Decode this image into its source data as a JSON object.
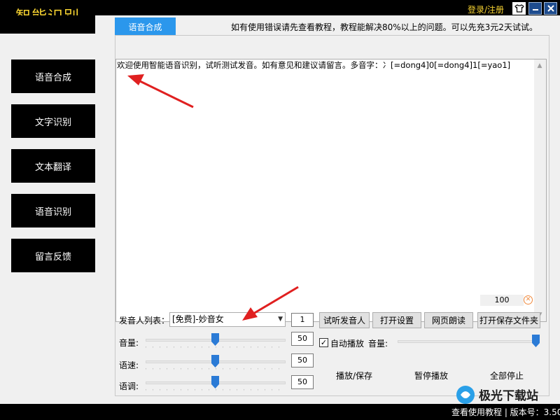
{
  "app": {
    "title": "智能识别",
    "login_label": "登录/注册",
    "notice": "如有使用错误请先查看教程，教程能解决80%以上的问题。可以先充3元2天试试。"
  },
  "sidebar": {
    "items": [
      {
        "label": "语音合成"
      },
      {
        "label": "文字识别"
      },
      {
        "label": "文本翻译"
      },
      {
        "label": "语音识别"
      },
      {
        "label": "留言反馈"
      }
    ]
  },
  "tab": {
    "label": "语音合成"
  },
  "editor": {
    "text": "欢迎使用智能语音识别，试听测试发音。如有意见和建议请留言。多音字：冫[=dong4]0[=dong4]1[=yao1]",
    "char_count": "100"
  },
  "voice": {
    "list_label": "发音人列表：",
    "selected": "[免费]-妙音女",
    "count": "1"
  },
  "buttons": {
    "preview": "试听发音人",
    "settings": "打开设置",
    "web_read": "网页朗读",
    "open_folder": "打开保存文件夹"
  },
  "sliders": {
    "volume": {
      "label": "音量:",
      "value": "50"
    },
    "speed": {
      "label": "语速:",
      "value": "50"
    },
    "pitch": {
      "label": "语调:",
      "value": "50"
    },
    "play_volume": {
      "label": "音量:"
    }
  },
  "playback": {
    "auto_play": "自动播放",
    "play_save": "播放/保存",
    "pause": "暂停播放",
    "stop_all": "全部停止"
  },
  "footer": {
    "link": "查看使用教程 | 版本号：3.50"
  },
  "watermark": {
    "text": "极光下载站"
  },
  "colors": {
    "accent_yellow": "#f7d331",
    "tab_blue": "#2b97ec",
    "slider_blue": "#2b7bd6",
    "arrow_red": "#e02020"
  }
}
